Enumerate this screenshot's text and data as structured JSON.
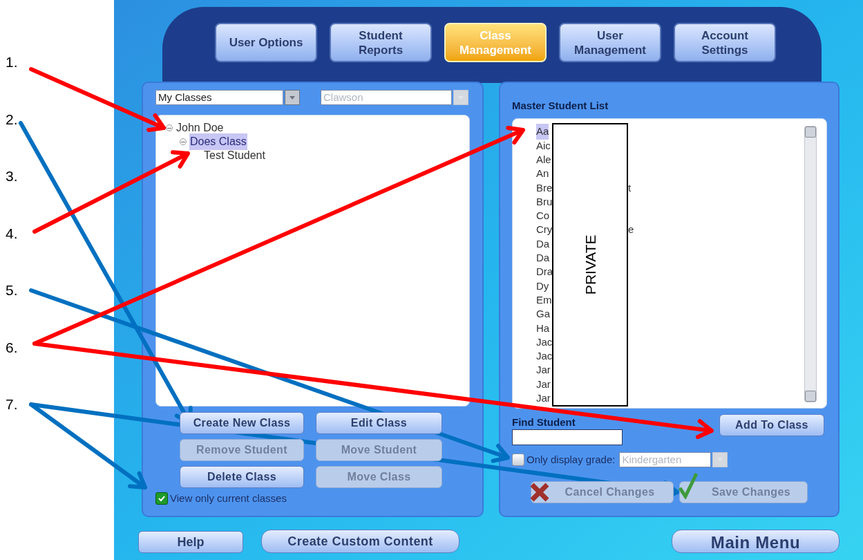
{
  "annotations": {
    "labels": [
      "1.",
      "2.",
      "3.",
      "4.",
      "5.",
      "6.",
      "7."
    ],
    "arrows": [
      {
        "color": "#ff0000"
      },
      {
        "color": "#0070c0"
      },
      {
        "color": "#ff0000"
      },
      {
        "color": "#0070c0"
      },
      {
        "color": "#ff0000"
      },
      {
        "color": "#ff0000"
      },
      {
        "color": "#0070c0"
      },
      {
        "color": "#0070c0"
      }
    ]
  },
  "tabs": [
    {
      "label": "User Options",
      "selected": false
    },
    {
      "label": "Student Reports",
      "selected": false
    },
    {
      "label": "Class Management",
      "selected": true
    },
    {
      "label": "User Management",
      "selected": false
    },
    {
      "label": "Account Settings",
      "selected": false
    }
  ],
  "class_panel": {
    "view_dropdown": {
      "value": "My Classes",
      "disabled": false
    },
    "school_dropdown": {
      "value": "Clawson",
      "disabled": true
    },
    "tree": [
      {
        "label": "John Doe",
        "expanded": true,
        "selected": false,
        "children": [
          {
            "label": "Does Class",
            "expanded": true,
            "selected": true,
            "children": [
              {
                "label": "Test Student",
                "selected": false
              }
            ]
          }
        ]
      }
    ],
    "buttons": [
      {
        "label": "Create New Class",
        "disabled": false
      },
      {
        "label": "Edit Class",
        "disabled": false
      },
      {
        "label": "Remove Student",
        "disabled": true
      },
      {
        "label": "Move Student",
        "disabled": true
      },
      {
        "label": "Delete Class",
        "disabled": false
      },
      {
        "label": "Move Class",
        "disabled": true
      }
    ],
    "current_only": {
      "label": "View only current classes",
      "checked": true
    }
  },
  "student_panel": {
    "title": "Master Student List",
    "students": [
      {
        "name": "Aa",
        "selected": true
      },
      {
        "name": "Aic",
        "selected": false
      },
      {
        "name": "Ale",
        "selected": false
      },
      {
        "name": "An",
        "selected": false
      },
      {
        "name": "Bre",
        "tail": "t",
        "selected": false
      },
      {
        "name": "Bru",
        "selected": false
      },
      {
        "name": "Co",
        "selected": false
      },
      {
        "name": "Cry",
        "tail": "e",
        "selected": false
      },
      {
        "name": "Da",
        "selected": false
      },
      {
        "name": "Da",
        "selected": false
      },
      {
        "name": "Dra",
        "selected": false
      },
      {
        "name": "Dy",
        "selected": false
      },
      {
        "name": "Em",
        "selected": false
      },
      {
        "name": "Ga",
        "selected": false
      },
      {
        "name": "Ha",
        "selected": false
      },
      {
        "name": "Jac",
        "selected": false
      },
      {
        "name": "Jac",
        "selected": false
      },
      {
        "name": "Jar",
        "selected": false
      },
      {
        "name": "Jar",
        "selected": false
      },
      {
        "name": "Jar",
        "selected": false
      }
    ],
    "redaction": "PRIVATE",
    "find_label": "Find Student",
    "add_button": {
      "label": "Add To Class",
      "disabled": false
    },
    "grade_filter": {
      "label": "Only display grade:",
      "checked": false,
      "value": "Kindergarten",
      "disabled": true
    },
    "cancel_button": {
      "label": "Cancel Changes",
      "disabled": true
    },
    "save_button": {
      "label": "Save Changes",
      "disabled": true
    }
  },
  "footer": {
    "help": "Help",
    "custom_content": "Create Custom Content",
    "main_menu": "Main Menu"
  }
}
